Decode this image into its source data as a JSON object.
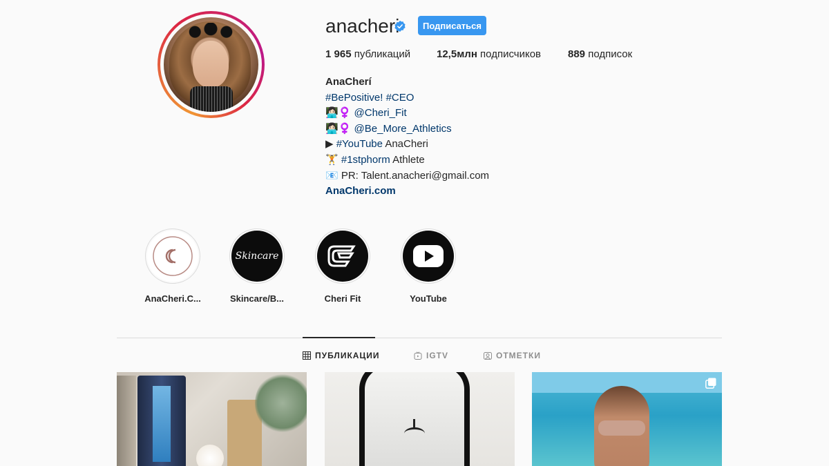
{
  "profile": {
    "username": "anacheri",
    "follow_label": "Подписаться",
    "stats": {
      "posts_count": "1 965",
      "posts_label": " публикаций",
      "followers_count": "12,5млн",
      "followers_label": " подписчиков",
      "following_count": "889",
      "following_label": " подписок"
    },
    "bio": {
      "name": "AnaCherí",
      "line1_tag1": "#BePositive!",
      "line1_tag2": "#CEO",
      "line2_prefix": "👩🏻‍💻‍♀ ",
      "line2_link": "@Cheri_Fit",
      "line3_prefix": "👩🏻‍💻‍♀ ",
      "line3_link": "@Be_More_Athletics",
      "line4_prefix": "▶ ",
      "line4_tag": "#YouTube",
      "line4_rest": " AnaCheri",
      "line5_prefix": "🏋 ",
      "line5_tag": "#1stphorm",
      "line5_rest": " Athlete",
      "line6": "📧 PR: Talent.anacheri@gmail.com",
      "website": "AnaCheri.com"
    }
  },
  "highlights": [
    {
      "label": "AnaCheri.C...",
      "icon": "cc-logo-icon",
      "text": "CC"
    },
    {
      "label": "Skincare/B...",
      "icon": "skincare-icon",
      "text": "Skincare"
    },
    {
      "label": "Cheri Fit",
      "icon": "cheri-fit-logo-icon",
      "text": ""
    },
    {
      "label": "YouTube",
      "icon": "youtube-icon",
      "text": ""
    }
  ],
  "tabs": [
    {
      "label": "ПУБЛИКАЦИИ",
      "icon": "grid-icon",
      "active": true
    },
    {
      "label": "IGTV",
      "icon": "igtv-icon",
      "active": false
    },
    {
      "label": "ОТМЕТКИ",
      "icon": "tagged-icon",
      "active": false
    }
  ],
  "colors": {
    "accent": "#3897f0",
    "link": "#00376b",
    "text": "#262626",
    "muted": "#8e8e8e",
    "background": "#fafafa"
  }
}
